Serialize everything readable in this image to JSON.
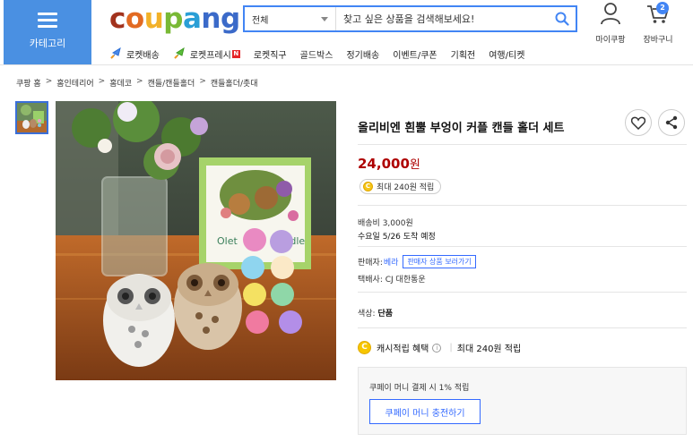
{
  "header": {
    "category_label": "카테고리",
    "logo": [
      "c",
      "o",
      "u",
      "p",
      "a",
      "n",
      "g"
    ],
    "search": {
      "category": "전체",
      "placeholder": "찾고 싶은 상품을 검색해보세요!"
    },
    "mycoupang_label": "마이쿠팡",
    "cart_label": "장바구니",
    "cart_count": "2",
    "brand_colors": {
      "category_bg": "#4a90e2",
      "accent": "#346aff",
      "price": "#ae0000"
    }
  },
  "nav": {
    "items": [
      {
        "label": "로켓배송",
        "icon": "rocket-icon"
      },
      {
        "label": "로켓프레시",
        "icon": "rocket-fresh-icon",
        "badge": "N"
      },
      {
        "label": "로켓직구"
      },
      {
        "label": "골드박스"
      },
      {
        "label": "정기배송"
      },
      {
        "label": "이벤트/쿠폰"
      },
      {
        "label": "기획전"
      },
      {
        "label": "여행/티켓"
      }
    ]
  },
  "breadcrumb": [
    "쿠팡 홈",
    "홈인테리어",
    "홈데코",
    "캔들/캔들홀더",
    "캔들홀더/촛대"
  ],
  "product": {
    "title": "올리비엔 흰뿔 부엉이 커플 캔들 홀더 세트",
    "price": "24,000",
    "price_unit": "원",
    "reward": "최대 240원 적립",
    "shipping_fee": "배송비 3,000원",
    "delivery": "수요일 5/26 도착 예정",
    "seller_label": "판매자:",
    "seller_name": "베라",
    "seller_link": "판매자 상품 보러가기",
    "courier": "택배사: CJ 대한통운",
    "option_label": "색상:",
    "option_value": "단품",
    "cashback_label": "캐시적립 혜택",
    "cashback_value": "최대 240원 적립",
    "coupay_text": "쿠페이 머니 결제 시 1% 적립",
    "coupay_button": "쿠페이 머니 충전하기",
    "image_text": {
      "box_left": "Olet",
      "box_right": "Candle"
    }
  }
}
